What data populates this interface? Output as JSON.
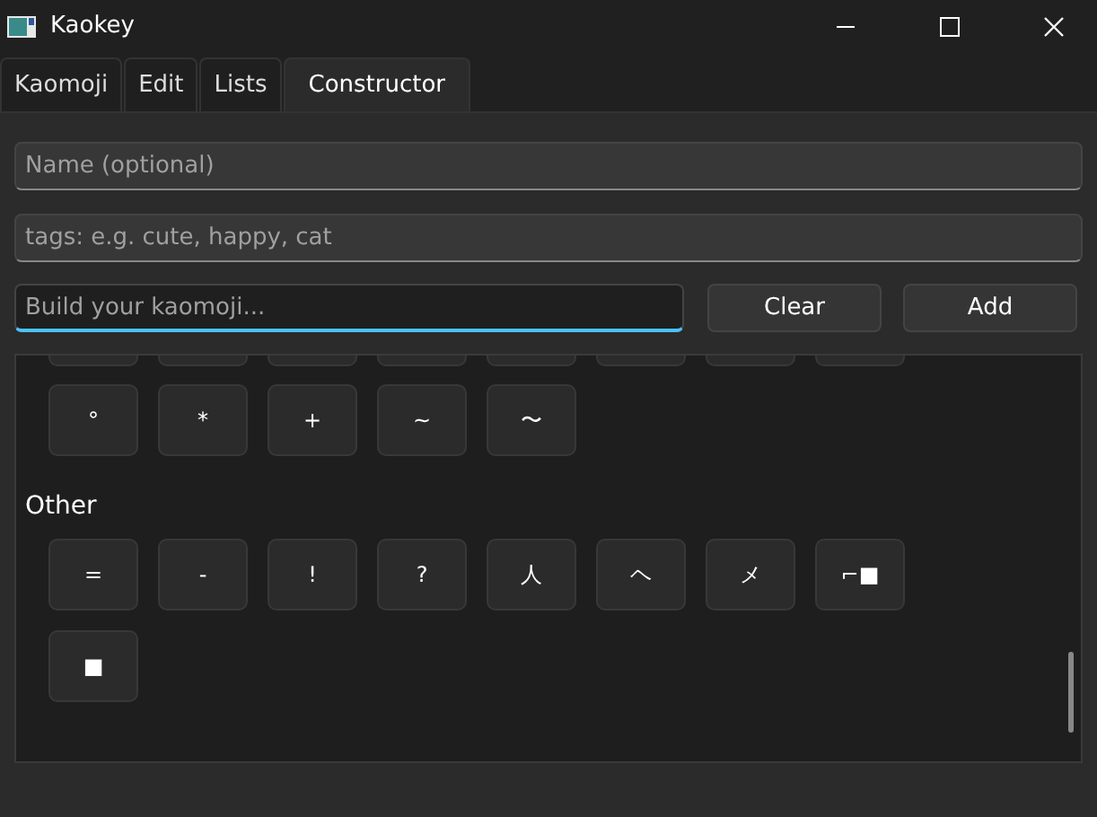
{
  "window": {
    "title": "Kaokey"
  },
  "tabs": [
    {
      "label": "Kaomoji",
      "selected": false
    },
    {
      "label": "Edit",
      "selected": false
    },
    {
      "label": "Lists",
      "selected": false
    },
    {
      "label": "Constructor",
      "selected": true
    }
  ],
  "name_field": {
    "placeholder": "Name (optional)"
  },
  "tags_field": {
    "placeholder": "tags: e.g. cute, happy, cat"
  },
  "build_field": {
    "placeholder": "Build your kaomoji...",
    "focused": true
  },
  "buttons": [
    "Clear",
    "Add"
  ],
  "sections": [
    {
      "keys": [
        "°",
        "*",
        "+",
        "~",
        "〜"
      ]
    },
    {
      "title": "Other",
      "keys": [
        "=",
        "-",
        "!",
        "?",
        "人",
        "ヘ",
        "メ",
        "⌐■",
        "■"
      ]
    }
  ]
}
